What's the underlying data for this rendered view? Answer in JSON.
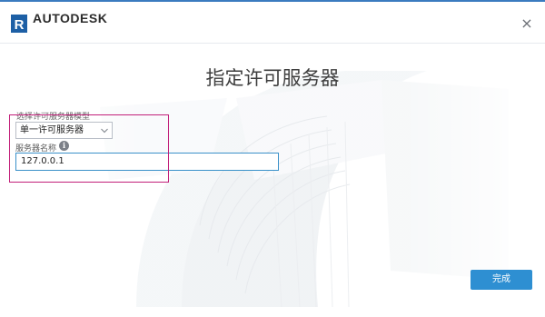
{
  "window": {
    "brand": "AUTODESK",
    "brand_mark": "R",
    "close_glyph": "×"
  },
  "page": {
    "title": "指定许可服务器"
  },
  "form": {
    "license_type_label": "选择许可服务器模型",
    "license_type_value": "单一许可服务器",
    "server_name_label": "服务器名称",
    "info_glyph": "i",
    "server_name_value": "127.0.0.1"
  },
  "actions": {
    "finish_label": "完成"
  },
  "colors": {
    "accent": "#2e8fd2",
    "highlight": "#c2207a",
    "input_focus": "#3a91c9"
  },
  "icons": {
    "logo": "revit-logo-icon",
    "close": "close-icon",
    "dropdown": "chevron-down-icon",
    "info": "info-icon"
  }
}
